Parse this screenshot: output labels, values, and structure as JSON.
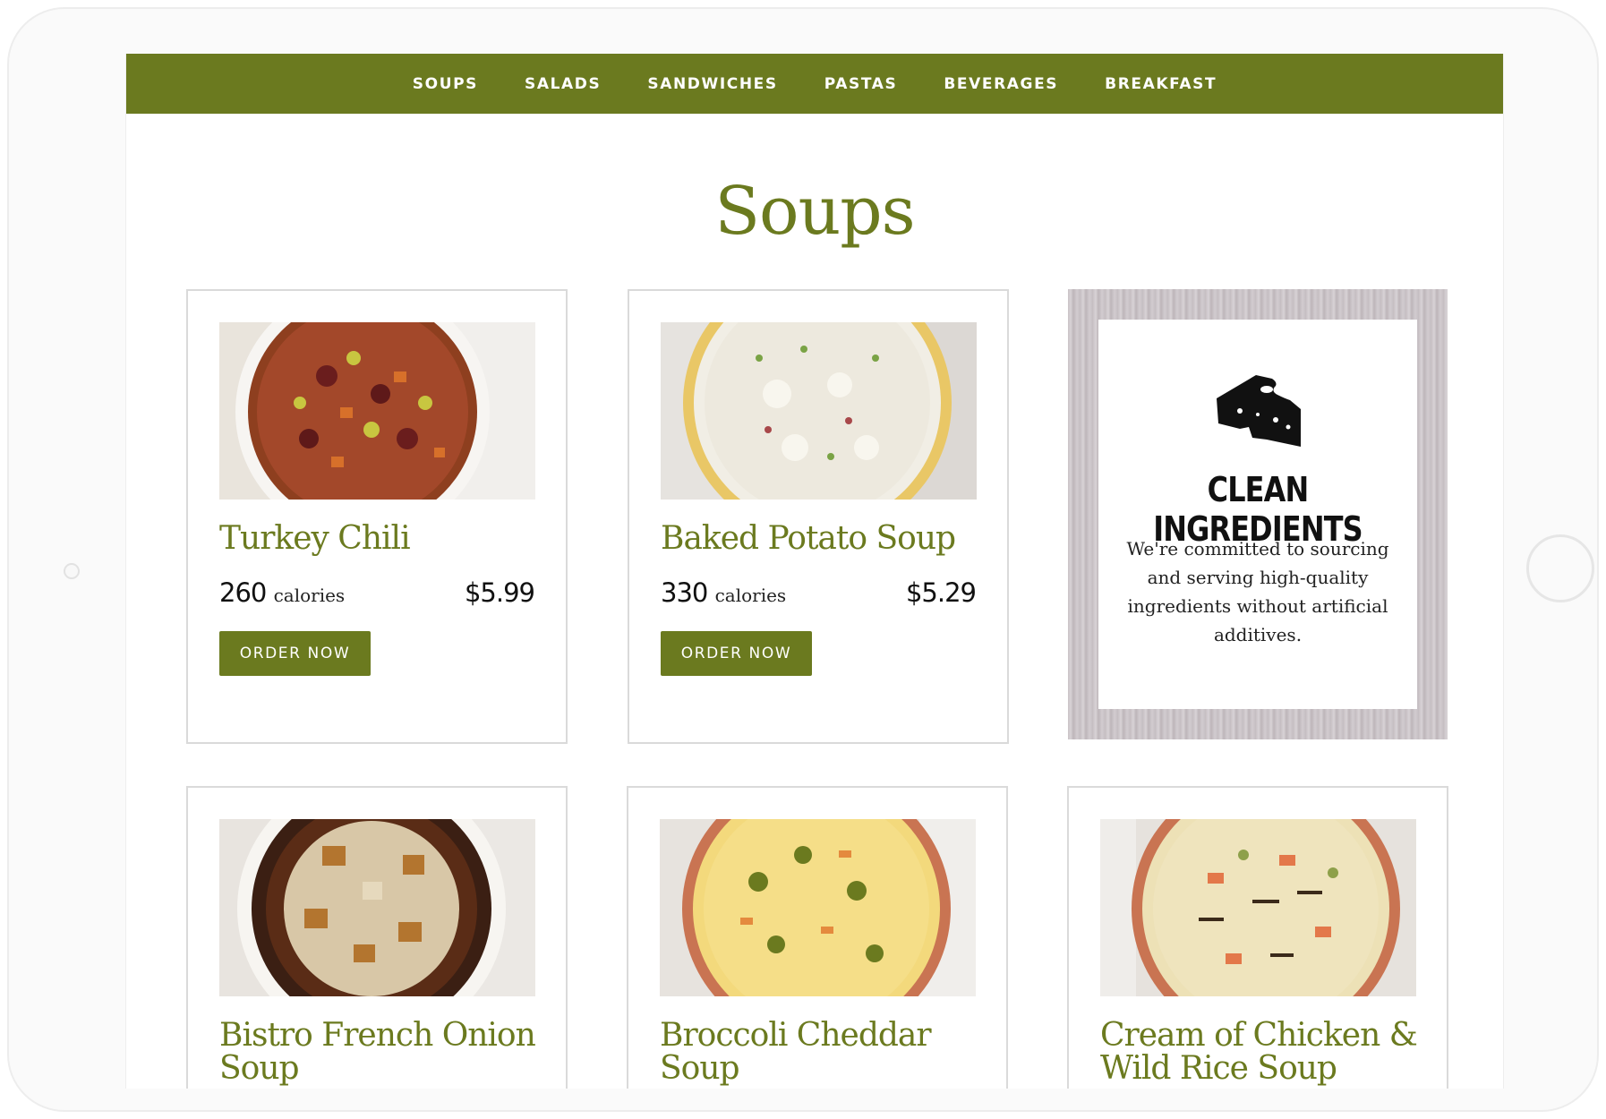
{
  "nav": {
    "items": [
      "SOUPS",
      "SALADS",
      "SANDWICHES",
      "PASTAS",
      "BEVERAGES",
      "BREAKFAST"
    ]
  },
  "page": {
    "title": "Soups"
  },
  "cards": [
    {
      "title": "Turkey Chili",
      "calories": "260",
      "calories_unit": "calories",
      "price": "$5.99",
      "button": "ORDER NOW"
    },
    {
      "title": "Baked Potato Soup",
      "calories": "330",
      "calories_unit": "calories",
      "price": "$5.29",
      "button": "ORDER NOW"
    },
    {
      "title": "Bistro French Onion Soup"
    },
    {
      "title": "Broccoli Cheddar Soup"
    },
    {
      "title": "Cream of Chicken & Wild Rice Soup"
    }
  ],
  "promo": {
    "icon": "cheese-icon",
    "title": "CLEAN INGREDIENTS",
    "text": "We're committed to sourcing and serving high-quality ingredients without artificial additives."
  },
  "colors": {
    "brand": "#6b7a1f",
    "border": "#dadada"
  }
}
